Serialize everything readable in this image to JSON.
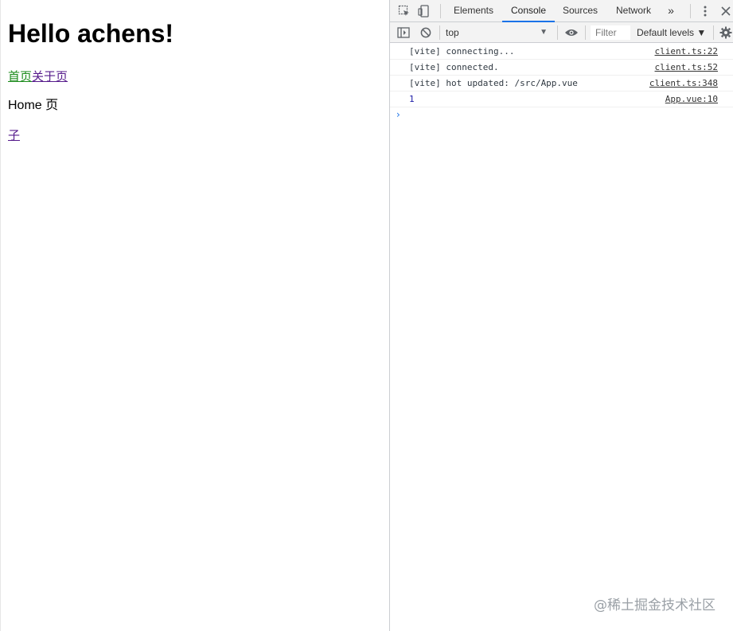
{
  "page": {
    "heading": "Hello achens!",
    "nav": {
      "home_link": "首页",
      "about_link": "关于页"
    },
    "home_text": "Home 页",
    "child_link": "子"
  },
  "devtools": {
    "tabs": [
      {
        "label": "Elements"
      },
      {
        "label": "Console",
        "selected": true
      },
      {
        "label": "Sources"
      },
      {
        "label": "Network"
      }
    ],
    "more_tabs": "»",
    "toolbar": {
      "context": "top",
      "filter_placeholder": "Filter",
      "levels": "Default levels ▼"
    },
    "messages": [
      {
        "text": "[vite] connecting...",
        "source": "client.ts:22"
      },
      {
        "text": "[vite] connected.",
        "source": "client.ts:52"
      },
      {
        "text": "[vite] hot updated: /src/App.vue",
        "source": "client.ts:348"
      },
      {
        "text": "1",
        "source": "App.vue:10"
      }
    ],
    "prompt": "›"
  },
  "watermark": "@稀土掘金技术社区",
  "colors": {
    "accent": "#1a73e8",
    "active_link": "#1a8a1a",
    "visited_link": "#551a8b",
    "number": "#1a1aa6"
  },
  "icons": [
    "inspect-icon",
    "device-toggle-icon",
    "kebab-menu-icon",
    "close-icon",
    "sidebar-toggle-icon",
    "clear-console-icon",
    "eye-icon",
    "gear-icon"
  ]
}
